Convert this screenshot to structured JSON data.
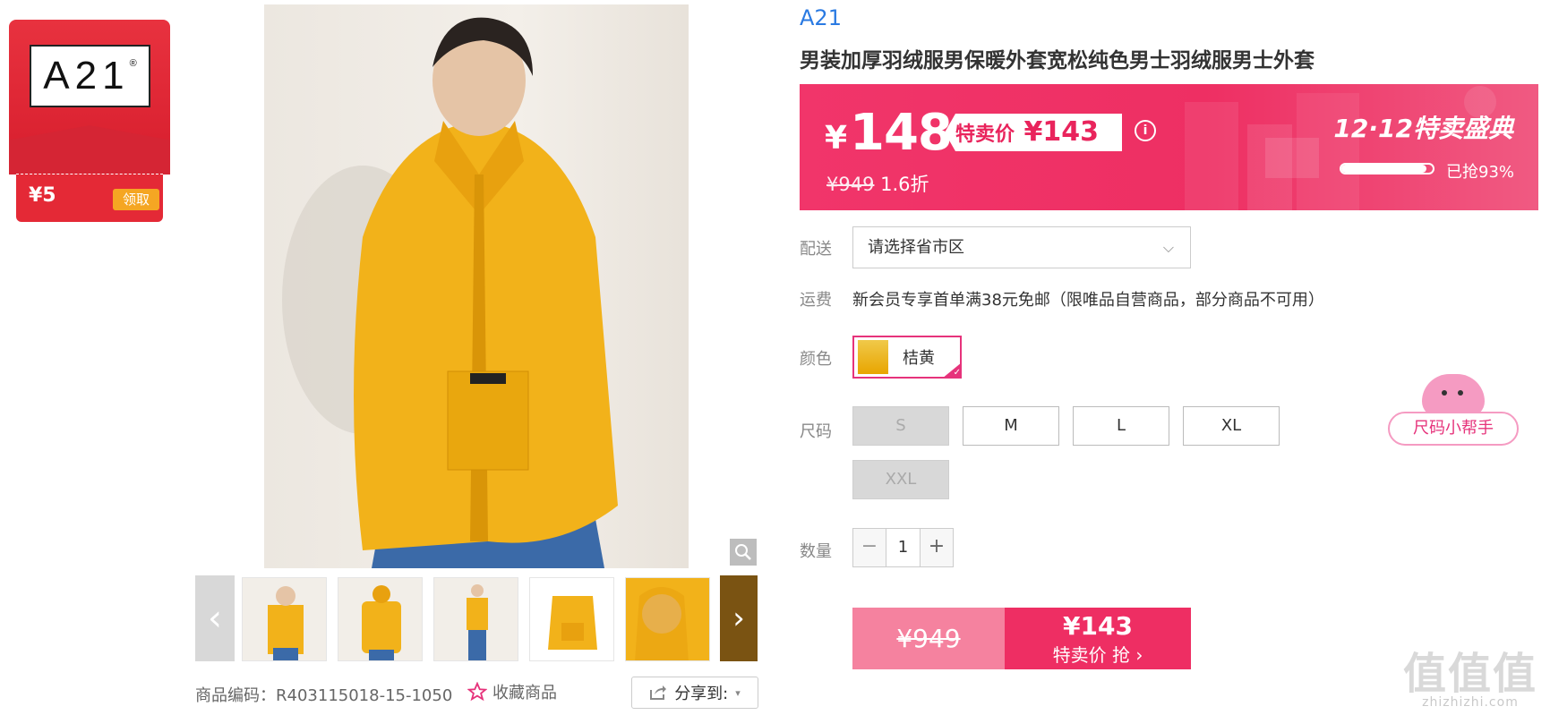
{
  "coupon": {
    "logo": "A21",
    "logo_mark": "®",
    "amount": "¥5",
    "button": "领取"
  },
  "product": {
    "brand": "A21",
    "title": "男装加厚羽绒服男保暖外套宽松纯色男士羽绒服男士外套",
    "sku_label": "商品编码：R403115018-15-1050",
    "favorite": "收藏商品",
    "share": "分享到:"
  },
  "price": {
    "yen": "¥",
    "current": "148",
    "tag_label": "特卖价",
    "tag_price": "¥143",
    "original": "¥949",
    "discount": "1.6折",
    "event": "12·12特卖盛典",
    "sold_label": "已抢93%",
    "sold_percent": 93
  },
  "delivery": {
    "label": "配送",
    "placeholder": "请选择省市区"
  },
  "shipping": {
    "label": "运费",
    "text": "新会员专享首单满38元免邮（限唯品自营商品，部分商品不可用）"
  },
  "color": {
    "label": "颜色",
    "options": [
      {
        "name": "桔黄",
        "selected": true
      }
    ]
  },
  "size": {
    "label": "尺码",
    "options": [
      {
        "name": "S",
        "available": false
      },
      {
        "name": "M",
        "available": true
      },
      {
        "name": "L",
        "available": true
      },
      {
        "name": "XL",
        "available": true
      },
      {
        "name": "XXL",
        "available": false
      }
    ],
    "helper": "尺码小帮手"
  },
  "quantity": {
    "label": "数量",
    "value": "1",
    "minus": "−",
    "plus": "+"
  },
  "buy": {
    "original": "¥949",
    "price": "¥143",
    "label": "特卖价 抢 ›"
  },
  "watermark": {
    "big": "值值值",
    "small": "zhizhizhi.com"
  },
  "colors": {
    "accent": "#ee2e63",
    "brand_link": "#2a7ae2",
    "coupon_red": "#e42936"
  }
}
